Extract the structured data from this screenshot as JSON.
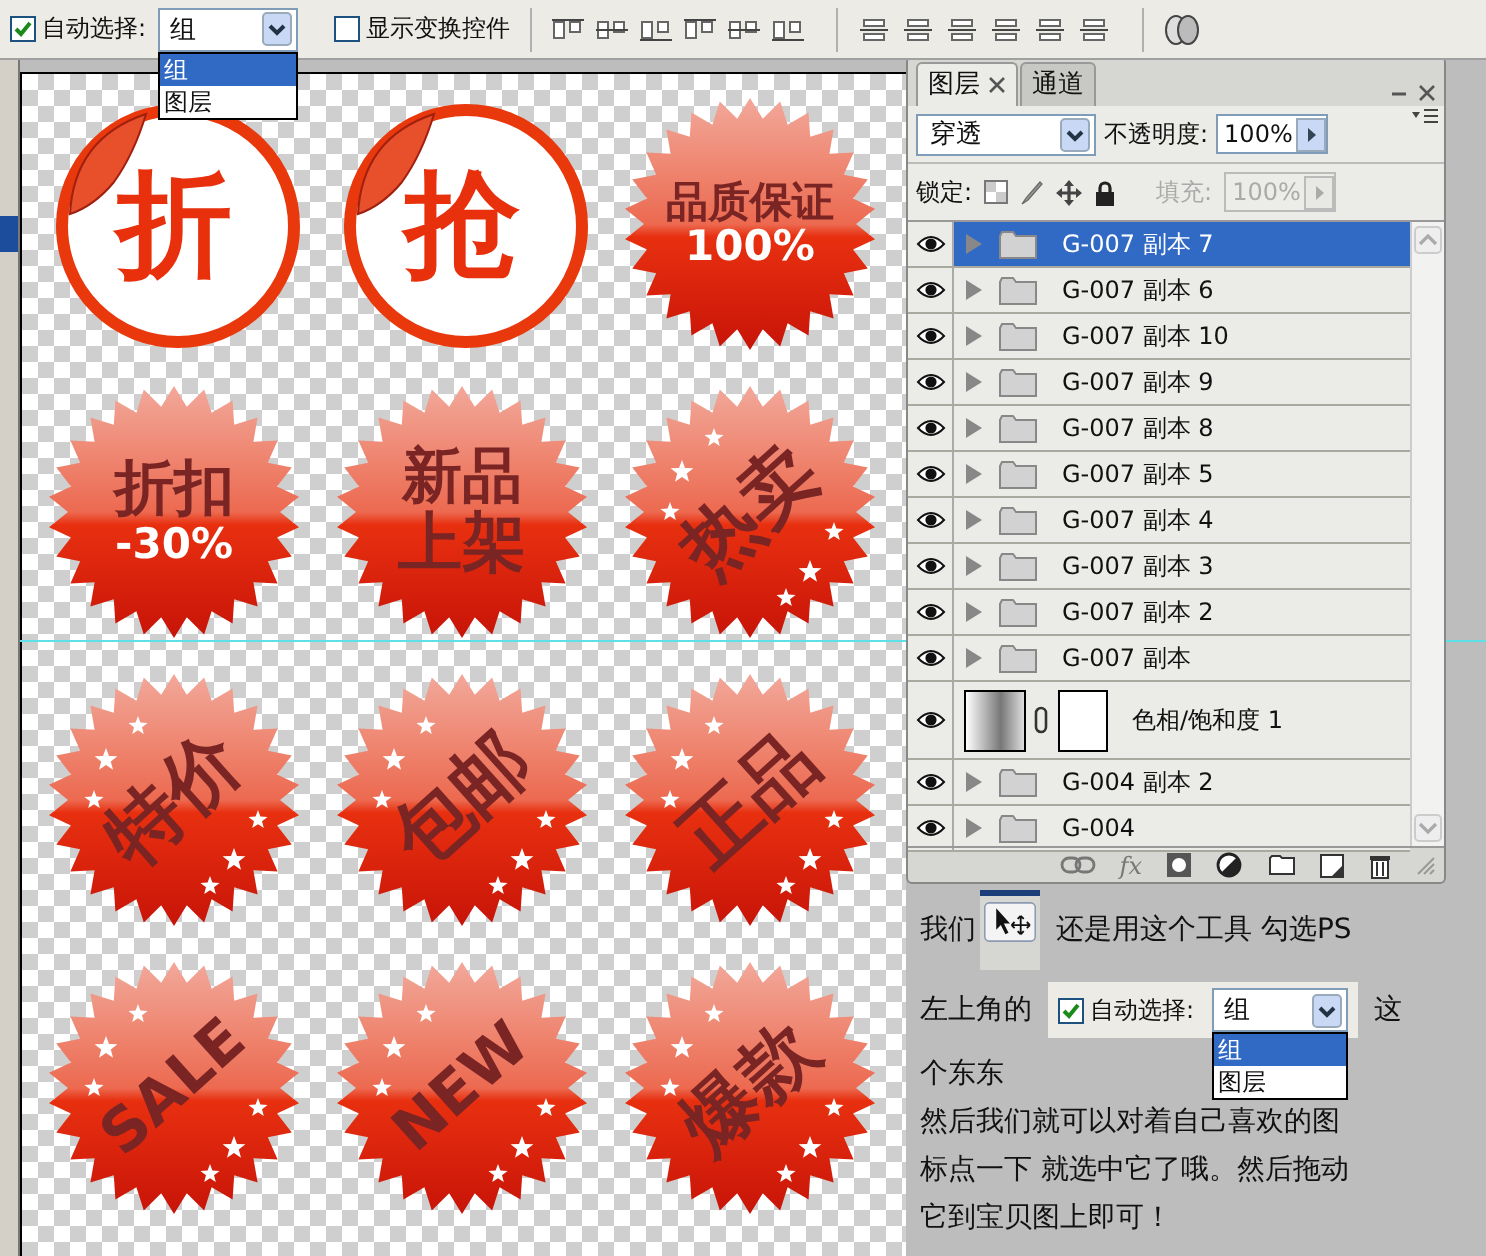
{
  "toolbar": {
    "auto_select": {
      "label": "自动选择:",
      "checked": true
    },
    "target": {
      "value": "组",
      "options": [
        {
          "label": "组",
          "selected": true
        },
        {
          "label": "图层",
          "selected": false
        }
      ]
    },
    "show_transform": {
      "label": "显示变换控件",
      "checked": false
    }
  },
  "badges": [
    {
      "kind": "sticker",
      "lines": [
        {
          "text": "折",
          "kind": "red"
        }
      ]
    },
    {
      "kind": "sticker",
      "lines": [
        {
          "text": "抢",
          "kind": "red"
        }
      ]
    },
    {
      "kind": "burst",
      "rotated": false,
      "sparkles": false,
      "lines": [
        {
          "text": "品质保证",
          "kind": "dark"
        },
        {
          "text": "100%",
          "kind": "light"
        }
      ]
    },
    {
      "kind": "burst",
      "rotated": false,
      "sparkles": false,
      "lines": [
        {
          "text": "折扣",
          "kind": "dark"
        },
        {
          "text": "-30%",
          "kind": "light"
        }
      ]
    },
    {
      "kind": "burst",
      "rotated": false,
      "sparkles": false,
      "lines": [
        {
          "text": "新品",
          "kind": "dark"
        },
        {
          "text": "上架",
          "kind": "dark"
        }
      ]
    },
    {
      "kind": "burst",
      "rotated": true,
      "sparkles": true,
      "lines": [
        {
          "text": "热卖",
          "kind": "dark"
        }
      ]
    },
    {
      "kind": "burst",
      "rotated": true,
      "sparkles": true,
      "lines": [
        {
          "text": "特价",
          "kind": "dark"
        }
      ]
    },
    {
      "kind": "burst",
      "rotated": true,
      "sparkles": true,
      "lines": [
        {
          "text": "包邮",
          "kind": "dark"
        }
      ]
    },
    {
      "kind": "burst",
      "rotated": true,
      "sparkles": true,
      "lines": [
        {
          "text": "正品",
          "kind": "dark"
        }
      ]
    },
    {
      "kind": "burst",
      "rotated": true,
      "sparkles": true,
      "lines": [
        {
          "text": "SALE",
          "kind": "dark"
        }
      ]
    },
    {
      "kind": "burst",
      "rotated": true,
      "sparkles": true,
      "lines": [
        {
          "text": "NEW",
          "kind": "dark"
        }
      ]
    },
    {
      "kind": "burst",
      "rotated": true,
      "sparkles": true,
      "lines": [
        {
          "text": "爆款",
          "kind": "dark"
        }
      ]
    }
  ],
  "layers_panel": {
    "tabs": [
      {
        "label": "图层",
        "selected": true,
        "closable": true
      },
      {
        "label": "通道",
        "selected": false,
        "closable": false
      }
    ],
    "blend_mode": "穿透",
    "opacity_label": "不透明度:",
    "opacity": "100%",
    "lock_label": "锁定:",
    "fill_label": "填充:",
    "fill": "100%",
    "fill_disabled": true,
    "fx_label": "fx",
    "layers": [
      {
        "kind": "group",
        "name": "G-007 副本 7",
        "selected": true,
        "visible": true
      },
      {
        "kind": "group",
        "name": "G-007 副本 6",
        "selected": false,
        "visible": true
      },
      {
        "kind": "group",
        "name": "G-007 副本 10",
        "selected": false,
        "visible": true
      },
      {
        "kind": "group",
        "name": "G-007 副本 9",
        "selected": false,
        "visible": true
      },
      {
        "kind": "group",
        "name": "G-007 副本 8",
        "selected": false,
        "visible": true
      },
      {
        "kind": "group",
        "name": "G-007 副本 5",
        "selected": false,
        "visible": true
      },
      {
        "kind": "group",
        "name": "G-007 副本 4",
        "selected": false,
        "visible": true
      },
      {
        "kind": "group",
        "name": "G-007 副本 3",
        "selected": false,
        "visible": true
      },
      {
        "kind": "group",
        "name": "G-007 副本 2",
        "selected": false,
        "visible": true
      },
      {
        "kind": "group",
        "name": "G-007 副本",
        "selected": false,
        "visible": true
      },
      {
        "kind": "adjustment",
        "name": "色相/饱和度 1",
        "selected": false,
        "visible": true
      },
      {
        "kind": "group",
        "name": "G-004 副本 2",
        "selected": false,
        "visible": true
      },
      {
        "kind": "group",
        "name": "G-004",
        "selected": false,
        "visible": true
      }
    ]
  },
  "instructions": {
    "lines": [
      {
        "parts": [
          {
            "kind": "text",
            "text": "我们"
          },
          {
            "kind": "tool_image"
          },
          {
            "kind": "text",
            "text": "还是用这个工具 勾选PS"
          }
        ]
      },
      {
        "parts": [
          {
            "kind": "text",
            "text": "左上角的"
          },
          {
            "kind": "options_image",
            "checked": true,
            "label": "自动选择:",
            "value": "组",
            "options": [
              {
                "label": "组",
                "selected": true
              },
              {
                "label": "图层",
                "selected": false
              }
            ]
          },
          {
            "kind": "text",
            "text": "这"
          }
        ]
      },
      {
        "parts": [
          {
            "kind": "text",
            "text": "个东东"
          }
        ]
      },
      {
        "parts": [
          {
            "kind": "text",
            "text": "然后我们就可以对着自己喜欢的图"
          }
        ]
      },
      {
        "parts": [
          {
            "kind": "text",
            "text": "标点一下 就选中它了哦。然后拖动"
          }
        ]
      },
      {
        "parts": [
          {
            "kind": "text",
            "text": "它到宝贝图上即可！"
          }
        ]
      }
    ]
  }
}
